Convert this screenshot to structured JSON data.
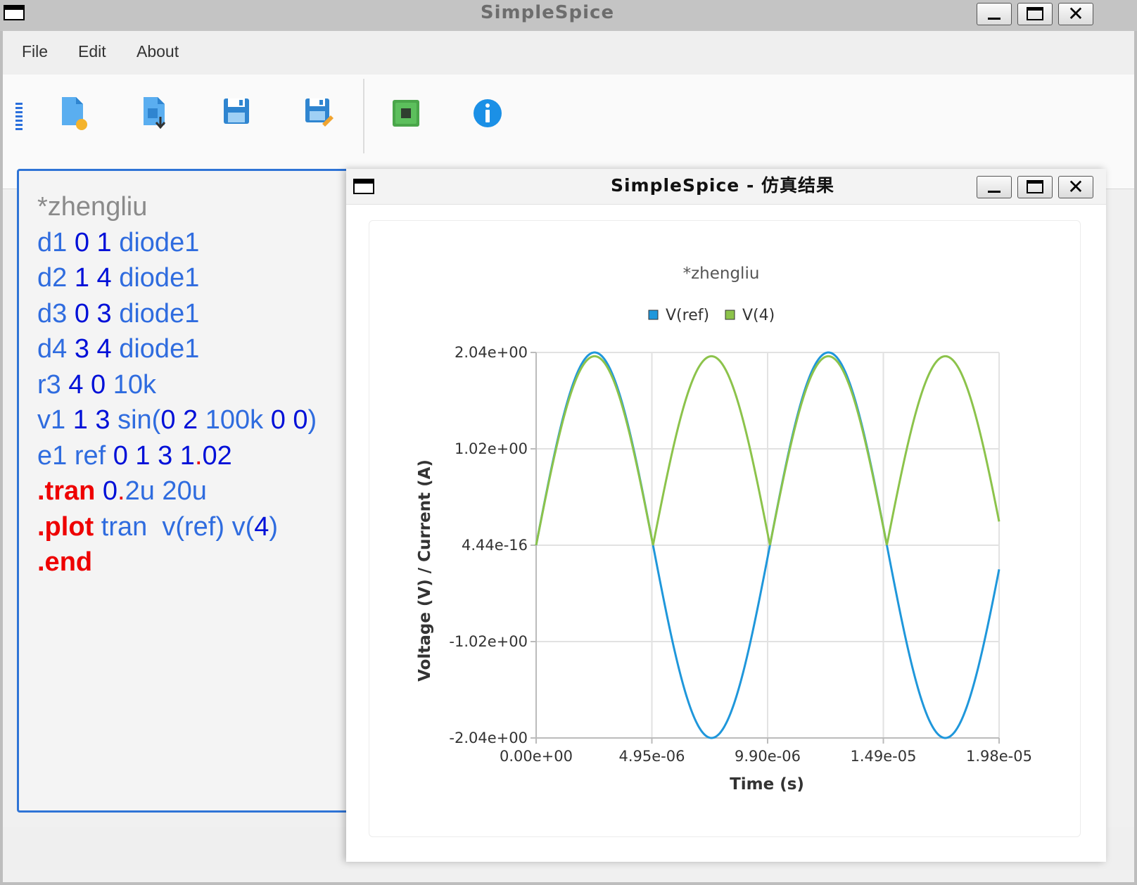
{
  "main_window": {
    "title": "SimpleSpice",
    "menu": [
      "File",
      "Edit",
      "About"
    ],
    "toolbar": [
      "new-file-icon",
      "import-file-icon",
      "save-icon",
      "save-as-icon",
      "run-simulation-icon",
      "info-icon"
    ]
  },
  "editor": {
    "lines": [
      [
        {
          "t": "*zhengliu",
          "c": "com"
        }
      ],
      [
        {
          "t": "d1 ",
          "c": "id"
        },
        {
          "t": "0 1 ",
          "c": "num"
        },
        {
          "t": "diode1",
          "c": "id"
        }
      ],
      [
        {
          "t": "d2 ",
          "c": "id"
        },
        {
          "t": "1 4 ",
          "c": "num"
        },
        {
          "t": "diode1",
          "c": "id"
        }
      ],
      [
        {
          "t": "d3 ",
          "c": "id"
        },
        {
          "t": "0 3 ",
          "c": "num"
        },
        {
          "t": "diode1",
          "c": "id"
        }
      ],
      [
        {
          "t": "d4 ",
          "c": "id"
        },
        {
          "t": "3 4 ",
          "c": "num"
        },
        {
          "t": "diode1",
          "c": "id"
        }
      ],
      [
        {
          "t": "r3 ",
          "c": "id"
        },
        {
          "t": "4 0 ",
          "c": "num"
        },
        {
          "t": "10k",
          "c": "id"
        }
      ],
      [
        {
          "t": "v1 ",
          "c": "id"
        },
        {
          "t": "1 3 ",
          "c": "num"
        },
        {
          "t": "sin(",
          "c": "id"
        },
        {
          "t": "0 2 ",
          "c": "num"
        },
        {
          "t": "100k ",
          "c": "id"
        },
        {
          "t": "0 0",
          "c": "num"
        },
        {
          "t": ")",
          "c": "id"
        }
      ],
      [
        {
          "t": "e1 ref ",
          "c": "id"
        },
        {
          "t": "0 1 3 1",
          "c": "num"
        },
        {
          "t": ".",
          "c": "red"
        },
        {
          "t": "02",
          "c": "num"
        }
      ],
      [
        {
          "t": ".tran ",
          "c": "dir"
        },
        {
          "t": "0",
          "c": "num"
        },
        {
          "t": ".",
          "c": "red"
        },
        {
          "t": "2u 20u",
          "c": "id"
        }
      ],
      [
        {
          "t": ".plot ",
          "c": "dir"
        },
        {
          "t": "tran  v(ref) v(",
          "c": "id"
        },
        {
          "t": "4",
          "c": "num"
        },
        {
          "t": ")",
          "c": "id"
        }
      ],
      [
        {
          "t": ".end",
          "c": "dir"
        }
      ]
    ]
  },
  "result_window": {
    "title": "SimpleSpice - 仿真结果"
  },
  "colors": {
    "vref": "#1f97db",
    "v4": "#8cc34b"
  },
  "chart_data": {
    "type": "line",
    "title": "*zhengliu",
    "xlabel": "Time (s)",
    "ylabel": "Voltage (V) / Current (A)",
    "xlim": [
      0,
      1.98e-05
    ],
    "ylim": [
      -2.04,
      2.04
    ],
    "x_tick_values": [
      0,
      4.95e-06,
      9.9e-06,
      1.485e-05,
      1.98e-05
    ],
    "x_tick_labels": [
      "0.00e+00",
      "4.95e-06",
      "9.90e-06",
      "1.49e-05",
      "1.98e-05"
    ],
    "y_tick_values": [
      2.04,
      1.02,
      0,
      -1.02,
      -2.04
    ],
    "y_tick_labels": [
      "2.04e+00",
      "1.02e+00",
      "4.44e-16",
      "-1.02e+00",
      "-2.04e+00"
    ],
    "legend": "top-center",
    "grid": true,
    "series": [
      {
        "name": "V(ref)",
        "color": "#1f97db",
        "formula": "1.02*2*sin(2*pi*1e5*t)",
        "amplitude": 2.04,
        "frequency_hz": 100000
      },
      {
        "name": "V(4)",
        "color": "#8cc34b",
        "formula": "abs(2*sin(2*pi*1e5*t))",
        "amplitude": 2.0,
        "frequency_hz": 100000
      }
    ],
    "t_step": 2e-07
  }
}
